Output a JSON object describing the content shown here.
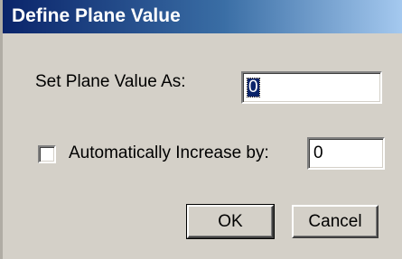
{
  "window": {
    "title": "Define Plane Value"
  },
  "plane_value": {
    "label": "Set Plane Value As:",
    "value": "0"
  },
  "auto_increase": {
    "label": "Automatically Increase by:",
    "checked": false,
    "value": "0"
  },
  "buttons": {
    "ok_label": "OK",
    "cancel_label": "Cancel"
  },
  "colors": {
    "titlebar_start": "#0a246a",
    "titlebar_end": "#a6caf0",
    "dialog_bg": "#d4d0c8"
  }
}
